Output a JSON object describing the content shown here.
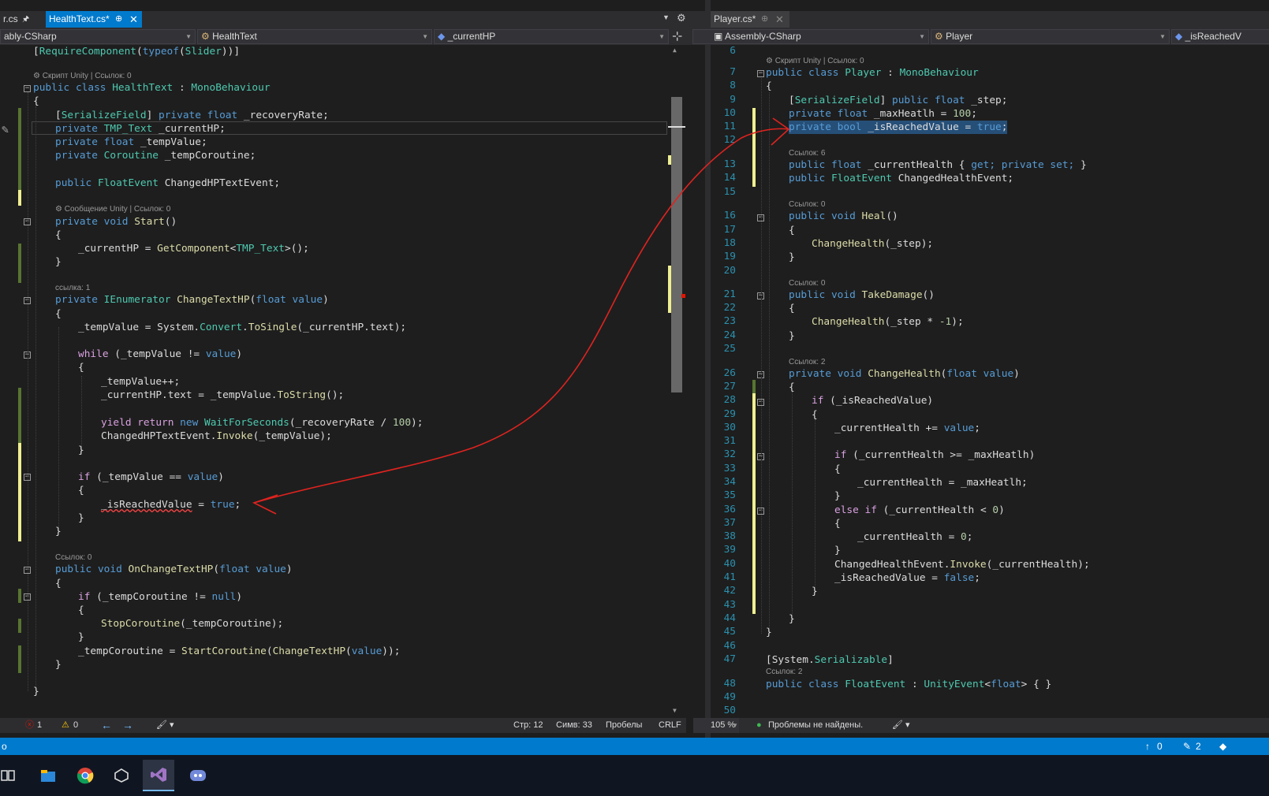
{
  "left": {
    "tabs": {
      "prev": "r.cs",
      "pin": "🖈",
      "active": "HealthText.cs*",
      "active_pin": "⊕",
      "close": "✕"
    },
    "nav": {
      "project": "ably-CSharp",
      "cls": "HealthText",
      "member": "_currentHP"
    },
    "code": {
      "attr_require": "RequireComponent",
      "typeof": "typeof",
      "slider": "Slider",
      "lens1": "⚙ Скрипт Unity | Ссылок: 0",
      "public": "public",
      "class": "class",
      "private": "private",
      "float": "float",
      "void": "void",
      "new": "new",
      "cls_name": "HealthText",
      "mono": "MonoBehaviour",
      "serialize": "SerializeField",
      "recovery": "_recoveryRate",
      "tmp": "TMP_Text",
      "curhp": "_currentHP",
      "tempval": "_tempValue",
      "coroutine": "Coroutine",
      "tempcor": "_tempCoroutine",
      "floatevent": "FloatEvent",
      "changedhp": "ChangedHPTextEvent",
      "lens2": "⚙ Сообщение Unity | Ссылок: 0",
      "start": "Start",
      "getcomp": "GetComponent",
      "lens3": "ссылка: 1",
      "ienum": "IEnumerator",
      "changetext": "ChangeTextHP",
      "value": "value",
      "system": "System.",
      "convert": "Convert",
      "tosingle": "ToSingle",
      "text": "_currentHP.text",
      "while": "while",
      "pp": "_tempValue++;",
      "tostring": "ToString",
      "yield": "yield return",
      "wait": "WaitForSeconds",
      "hundred": "100",
      "invoke": "Invoke",
      "if": "if",
      "isreached": "_isReachedValue",
      "true": "true",
      "lens4": "Ссылок: 0",
      "onchange": "OnChangeTextHP",
      "null": "null",
      "stop": "StopCoroutine",
      "startcor": "StartCoroutine"
    },
    "status": {
      "errors": "1",
      "warnings": "0",
      "line": "Стр: 12",
      "col": "Симв: 33",
      "spaces": "Пробелы",
      "eol": "CRLF"
    }
  },
  "right": {
    "tabs": {
      "active": "Player.cs*",
      "pin": "⊕",
      "close": "✕"
    },
    "nav": {
      "project": "Assembly-CSharp",
      "cls": "Player",
      "member": "_isReachedV"
    },
    "lines": [
      "6",
      "7",
      "8",
      "9",
      "10",
      "11",
      "12",
      "13",
      "14",
      "15",
      "16",
      "17",
      "18",
      "19",
      "20",
      "21",
      "22",
      "23",
      "24",
      "25",
      "26",
      "27",
      "28",
      "29",
      "30",
      "31",
      "32",
      "33",
      "34",
      "35",
      "36",
      "37",
      "38",
      "39",
      "40",
      "41",
      "42",
      "43",
      "44",
      "45",
      "46",
      "47",
      "48",
      "49",
      "50"
    ],
    "code": {
      "lens_unity": "⚙ Скрипт Unity | Ссылок: 0",
      "public": "public",
      "class": "class",
      "private": "private",
      "float": "float",
      "bool": "bool",
      "void": "void",
      "player": "Player",
      "mono": "MonoBehaviour",
      "serialize": "SerializeField",
      "step": "_step",
      "maxh": "_maxHeatlh",
      "hundred": "100",
      "isreached": "_isReachedValue",
      "true": "true",
      "false": "false",
      "lens6": "Ссылок: 6",
      "curh": "_currentHealth",
      "get": "get;",
      "set": "set;",
      "floatevent": "FloatEvent",
      "changedh": "ChangedHealthEvent",
      "lens0": "Ссылок: 0",
      "heal": "Heal",
      "changehealth": "ChangeHealth",
      "takedamage": "TakeDamage",
      "minus": "-1",
      "lens2": "Ссылок: 2",
      "value": "value",
      "if": "if",
      "else": "else if",
      "zero": "0",
      "invoke": "Invoke",
      "sysser": "System.",
      "serializable": "Serializable",
      "lens2b": "Ссылок: 2",
      "unityevent": "UnityEvent"
    },
    "status": {
      "zoom": "105 %",
      "ok": "Проблемы не найдены."
    }
  },
  "bottom": {
    "left": "о",
    "up": "0",
    "pen": "2"
  },
  "taskbar": {
    "icons": [
      "task-view-icon",
      "file-explorer-icon",
      "chrome-icon",
      "unity-icon",
      "visual-studio-icon",
      "discord-icon"
    ]
  },
  "colors": {
    "accent": "#007acc",
    "keyword": "#569cd6",
    "type": "#4ec9b0",
    "method": "#dcdcaa",
    "control": "#d8a0df",
    "number": "#b5cea8",
    "annotation_arrow": "#e0231f"
  }
}
